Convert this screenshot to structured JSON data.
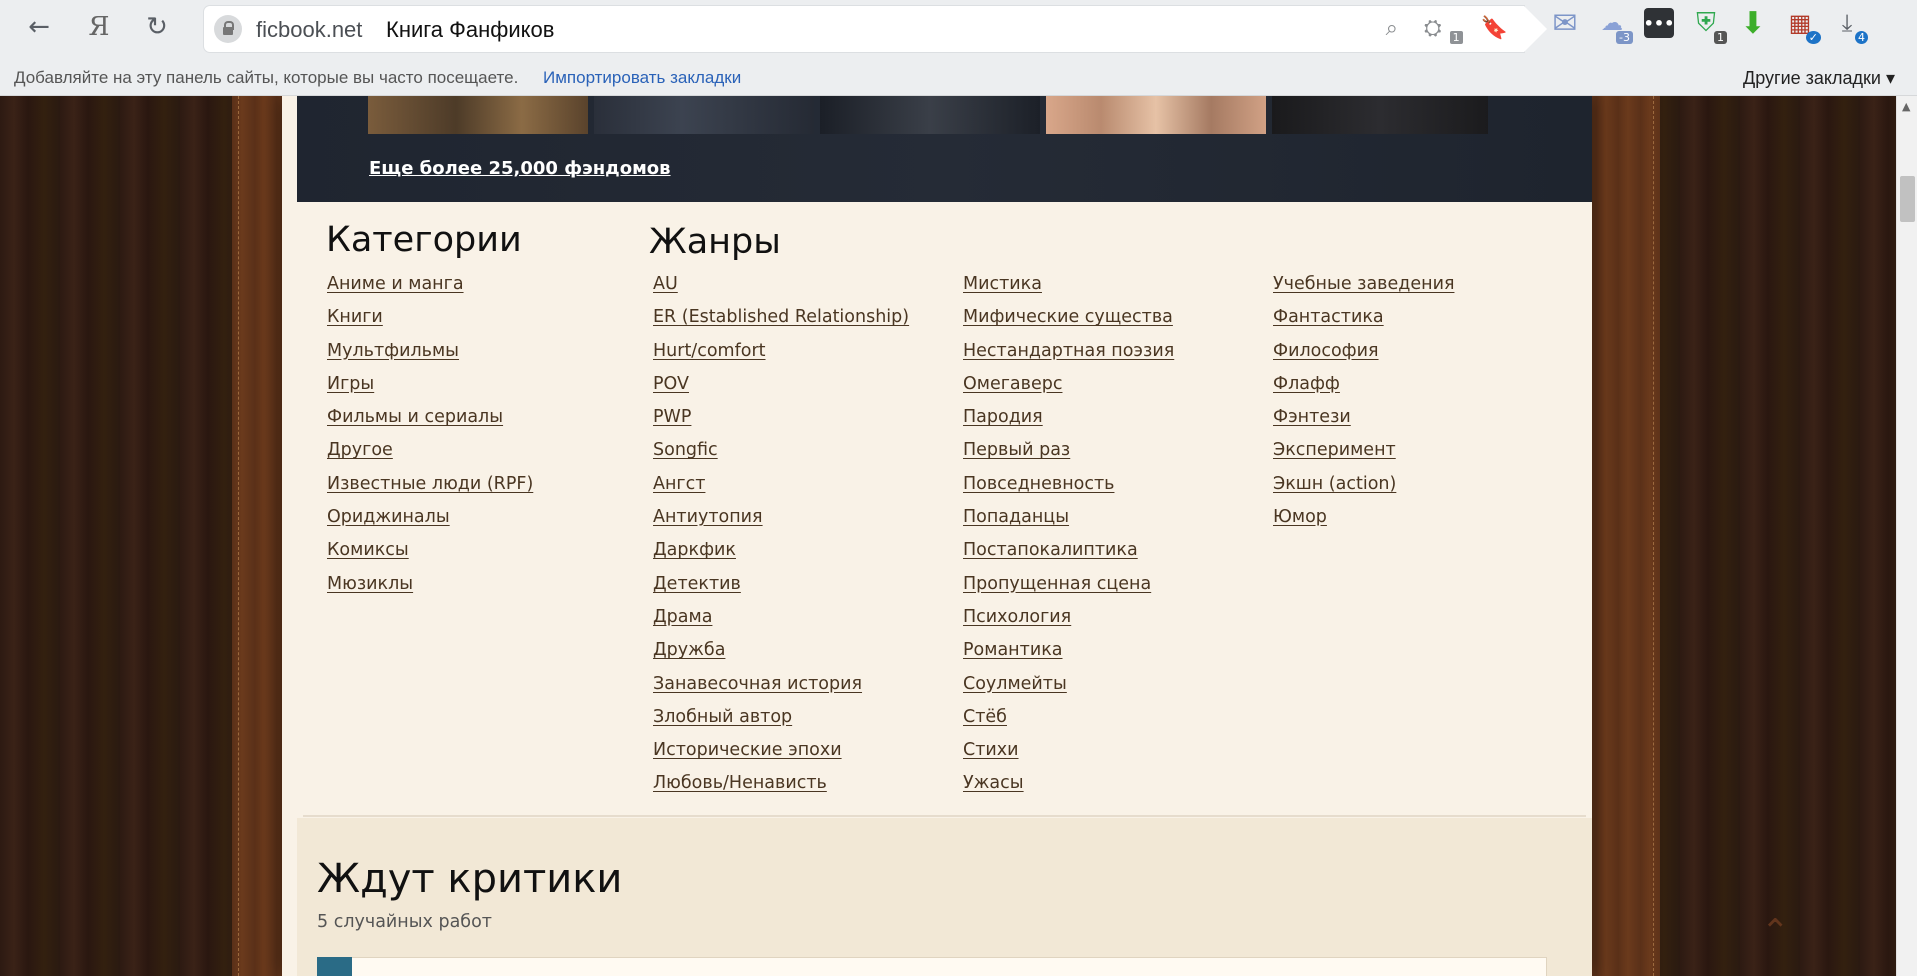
{
  "browser": {
    "domain": "ficbook.net",
    "page_title": "Книга Фанфиков",
    "nav": {
      "back_icon": "←",
      "yandex_icon": "Я",
      "reload_icon": "↻"
    },
    "omni_icons": {
      "search": "⌕",
      "translate_badge": "1",
      "bookmark": "🔖"
    },
    "extensions": {
      "mail_icon": "✉",
      "cloud_badge": "-3",
      "dots_icon": "•••",
      "shield_badge": "1",
      "download_arrow": "⬇",
      "calendar_badge": "✓",
      "downloads_badge": "4"
    },
    "bookmarks_bar": {
      "hint": "Добавляйте на эту панель сайты, которые вы часто посещаете.",
      "import_link": "Импортировать закладки",
      "other_bookmarks": "Другие закладки ▾"
    }
  },
  "banner": {
    "more_fandoms_link": "Еще более 25,000 фэндомов"
  },
  "categories": {
    "title": "Категории",
    "items": [
      "Аниме и манга",
      "Книги",
      "Мультфильмы",
      "Игры",
      "Фильмы и сериалы",
      "Другое",
      "Известные люди (RPF)",
      "Ориджиналы",
      "Комиксы",
      "Мюзиклы"
    ]
  },
  "genres": {
    "title": "Жанры",
    "col1": [
      "AU",
      "ER (Established Relationship)",
      "Hurt/comfort",
      "POV",
      "PWP",
      "Songfic",
      "Ангст",
      "Антиутопия",
      "Даркфик",
      "Детектив",
      "Драма",
      "Дружба",
      "Занавесочная история",
      "Злобный автор",
      "Исторические эпохи",
      "Любовь/Ненависть"
    ],
    "col2": [
      "Мистика",
      "Мифические существа",
      "Нестандартная поэзия",
      "Омегаверс",
      "Пародия",
      "Первый раз",
      "Повседневность",
      "Попаданцы",
      "Постапокалиптика",
      "Пропущенная сцена",
      "Психология",
      "Романтика",
      "Соулмейты",
      "Стёб",
      "Стихи",
      "Ужасы"
    ],
    "col3": [
      "Учебные заведения",
      "Фантастика",
      "Философия",
      "Флафф",
      "Фэнтези",
      "Эксперимент",
      "Экшн (action)",
      "Юмор"
    ]
  },
  "critics": {
    "title": "Ждут критики",
    "subtitle": "5 случайных работ"
  },
  "icons": {
    "scroll_up": "▲",
    "page_up": "⌃"
  }
}
